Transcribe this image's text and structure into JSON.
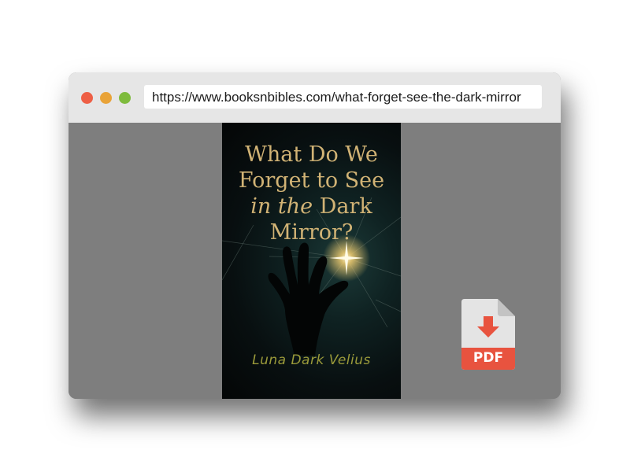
{
  "browser": {
    "url": "https://www.booksnbibles.com/what-forget-see-the-dark-mirror",
    "buttons": [
      "close",
      "minimize",
      "maximize"
    ]
  },
  "book": {
    "title_line1": "What Do We",
    "title_line2": "Forget to See",
    "title_line3_italic": "in the",
    "title_line3_rest": "Dark",
    "title_line4": "Mirror?",
    "author": "Luna Dark Velius"
  },
  "download": {
    "label": "PDF",
    "icon": "pdf-download-icon"
  },
  "colors": {
    "accent_red": "#e8533f",
    "title_gold": "#d1b375",
    "author_olive": "#9a9a3a",
    "titlebar": "#e6e6e6",
    "content_bg": "#7e7e7e"
  }
}
